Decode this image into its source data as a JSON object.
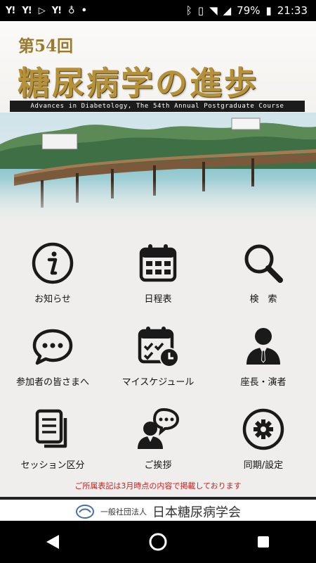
{
  "statusbar": {
    "battery": "79%",
    "time": "21:33",
    "notification_icons": [
      "yahoo-icon",
      "yahoo-icon",
      "play-icon",
      "yahoo-icon",
      "bulb-icon",
      "more-icon"
    ],
    "system_icons": [
      "bluetooth-icon",
      "vibrate-icon",
      "wifi-icon",
      "signal-icon",
      "battery-icon"
    ]
  },
  "header": {
    "edition": "第54回",
    "title": "糖尿病学の進歩",
    "subtitle": "Advances in Diabetology, The 54th Annual Postgraduate Course"
  },
  "menu": [
    {
      "label": "お知らせ",
      "icon": "info-icon"
    },
    {
      "label": "日程表",
      "icon": "calendar-icon"
    },
    {
      "label": "検　索",
      "icon": "search-icon"
    },
    {
      "label": "参加者の皆さまへ",
      "icon": "chat-bubble-icon"
    },
    {
      "label": "マイスケジュール",
      "icon": "calendar-clock-icon"
    },
    {
      "label": "座長・演者",
      "icon": "person-icon"
    },
    {
      "label": "セッション区分",
      "icon": "documents-icon"
    },
    {
      "label": "ご挨拶",
      "icon": "speaker-icon"
    },
    {
      "label": "同期/設定",
      "icon": "gear-icon"
    }
  ],
  "notice": "ご所属表記は3月時点の内容で掲載しております",
  "footer": {
    "org_type": "一般社団法人",
    "org_name": "日本糖尿病学会"
  },
  "colors": {
    "title_gold": "#b5913a",
    "notice_red": "#d21b1b",
    "icon_dark": "#1a1a1a"
  }
}
